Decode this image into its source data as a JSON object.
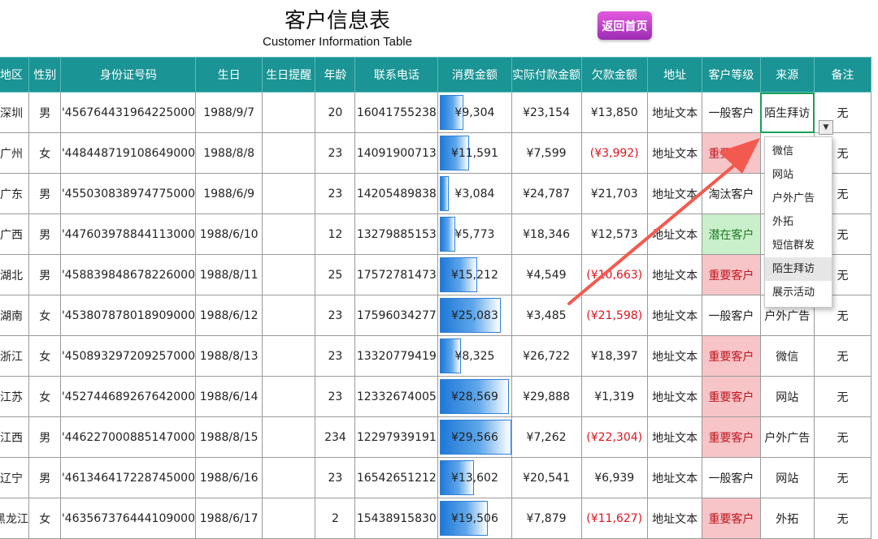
{
  "sheet": {
    "title": "客户信息表",
    "subtitle": "Customer Information Table",
    "back_button": "返回首页"
  },
  "table": {
    "headers": [
      "地区",
      "性别",
      "身份证号码",
      "生日",
      "生日提醒",
      "年龄",
      "联系电话",
      "消费金额",
      "实际付款金额",
      "欠款金额",
      "地址",
      "客户等级",
      "来源",
      "备注"
    ],
    "rows": [
      {
        "region": "深圳",
        "gender": "男",
        "id": "'456764431964225000",
        "birthday": "1988/9/7",
        "reminder": "",
        "age": "20",
        "phone": "16041755238",
        "spend": "¥9,304",
        "paid": "¥23,154",
        "debt": "¥13,850",
        "address": "地址文本",
        "level": "一般客户",
        "source": "陌生拜访",
        "note": "无"
      },
      {
        "region": "广州",
        "gender": "女",
        "id": "'448448719108649000",
        "birthday": "1988/8/8",
        "reminder": "",
        "age": "23",
        "phone": "14091900713",
        "spend": "¥11,591",
        "paid": "¥7,599",
        "debt": "(¥3,992)",
        "address": "地址文本",
        "level": "重要客户",
        "source": "",
        "note": "无"
      },
      {
        "region": "广东",
        "gender": "男",
        "id": "'455030838974775000",
        "birthday": "1988/6/9",
        "reminder": "",
        "age": "23",
        "phone": "14205489838",
        "spend": "¥3,084",
        "paid": "¥24,787",
        "debt": "¥21,703",
        "address": "地址文本",
        "level": "淘汰客户",
        "source": "",
        "note": "无"
      },
      {
        "region": "广西",
        "gender": "男",
        "id": "'447603978844113000",
        "birthday": "1988/6/10",
        "reminder": "",
        "age": "12",
        "phone": "13279885153",
        "spend": "¥5,773",
        "paid": "¥18,346",
        "debt": "¥12,573",
        "address": "地址文本",
        "level": "潜在客户",
        "source": "",
        "note": "无"
      },
      {
        "region": "湖北",
        "gender": "男",
        "id": "'458839848678226000",
        "birthday": "1988/8/11",
        "reminder": "",
        "age": "25",
        "phone": "17572781473",
        "spend": "¥15,212",
        "paid": "¥4,549",
        "debt": "(¥10,663)",
        "address": "地址文本",
        "level": "重要客户",
        "source": "",
        "note": "无"
      },
      {
        "region": "湖南",
        "gender": "女",
        "id": "'453807878018909000",
        "birthday": "1988/6/12",
        "reminder": "",
        "age": "23",
        "phone": "17596034277",
        "spend": "¥25,083",
        "paid": "¥3,485",
        "debt": "(¥21,598)",
        "address": "地址文本",
        "level": "一般客户",
        "source": "户外广告",
        "note": "无"
      },
      {
        "region": "浙江",
        "gender": "女",
        "id": "'450893297209257000",
        "birthday": "1988/8/13",
        "reminder": "",
        "age": "23",
        "phone": "13320779419",
        "spend": "¥8,325",
        "paid": "¥26,722",
        "debt": "¥18,397",
        "address": "地址文本",
        "level": "重要客户",
        "source": "微信",
        "note": "无"
      },
      {
        "region": "江苏",
        "gender": "女",
        "id": "'452744689267642000",
        "birthday": "1988/6/14",
        "reminder": "",
        "age": "23",
        "phone": "12332674005",
        "spend": "¥28,569",
        "paid": "¥29,888",
        "debt": "¥1,319",
        "address": "地址文本",
        "level": "重要客户",
        "source": "网站",
        "note": "无"
      },
      {
        "region": "江西",
        "gender": "男",
        "id": "'446227000885147000",
        "birthday": "1988/8/15",
        "reminder": "",
        "age": "234",
        "phone": "12297939191",
        "spend": "¥29,566",
        "paid": "¥7,262",
        "debt": "(¥22,304)",
        "address": "地址文本",
        "level": "重要客户",
        "source": "户外广告",
        "note": "无"
      },
      {
        "region": "辽宁",
        "gender": "男",
        "id": "'461346417228745000",
        "birthday": "1988/6/16",
        "reminder": "",
        "age": "23",
        "phone": "16542651212",
        "spend": "¥13,602",
        "paid": "¥20,541",
        "debt": "¥6,939",
        "address": "地址文本",
        "level": "一般客户",
        "source": "网站",
        "note": "无"
      },
      {
        "region": "黑龙江",
        "gender": "女",
        "id": "'463567376444109000",
        "birthday": "1988/6/17",
        "reminder": "",
        "age": "2",
        "phone": "15438915830",
        "spend": "¥19,506",
        "paid": "¥7,879",
        "debt": "(¥11,627)",
        "address": "地址文本",
        "level": "重要客户",
        "source": "外拓",
        "note": "无"
      }
    ]
  },
  "spend_values": [
    9304,
    11591,
    3084,
    5773,
    15212,
    25083,
    8325,
    28569,
    29566,
    13602,
    19506
  ],
  "spend_bar_max": 29566,
  "level_colors": {
    "重要客户": "#f7c4c7",
    "潜在客户": "#c9efcb"
  },
  "dropdown": {
    "items": [
      "微信",
      "网站",
      "户外广告",
      "外拓",
      "短信群发",
      "陌生拜访",
      "展示活动"
    ],
    "selected": "陌生拜访"
  },
  "accent_color": "#1a9494"
}
